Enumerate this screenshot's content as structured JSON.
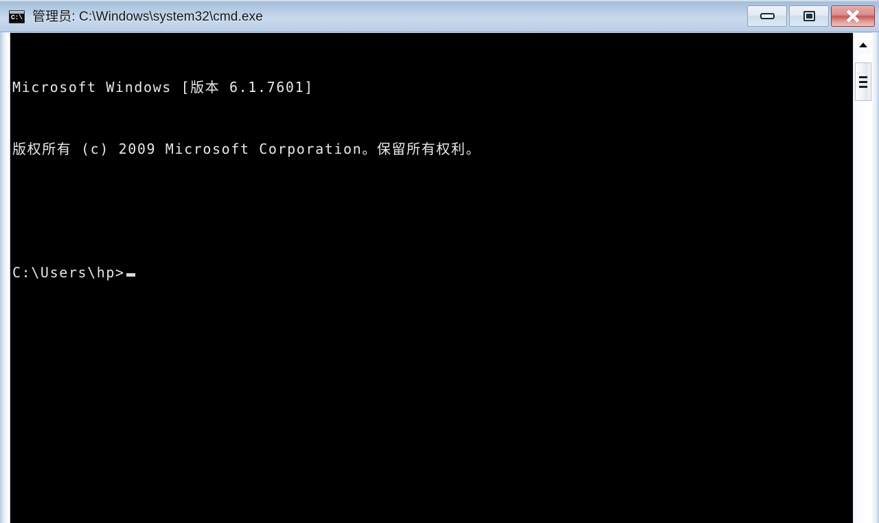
{
  "window": {
    "icon_name": "cmd-console-icon",
    "icon_glyph": "C:\\",
    "title": "管理员: C:\\Windows\\system32\\cmd.exe",
    "controls": {
      "minimize_label": "最小化",
      "maximize_label": "最大化",
      "close_label": "关闭"
    },
    "accent_title_bg": "#bdd1e7",
    "accent_close_bg": "#c45b57"
  },
  "console": {
    "background": "#000000",
    "foreground": "#e8e8e8",
    "lines": [
      "Microsoft Windows [版本 6.1.7601]",
      "版权所有 (c) 2009 Microsoft Corporation。保留所有权利。",
      "",
      ""
    ],
    "prompt": "C:\\Users\\hp>",
    "input_value": ""
  },
  "scrollbar": {
    "up_arrow_name": "scroll-up-arrow",
    "orientation": "vertical",
    "thumb_position_percent": 0
  }
}
